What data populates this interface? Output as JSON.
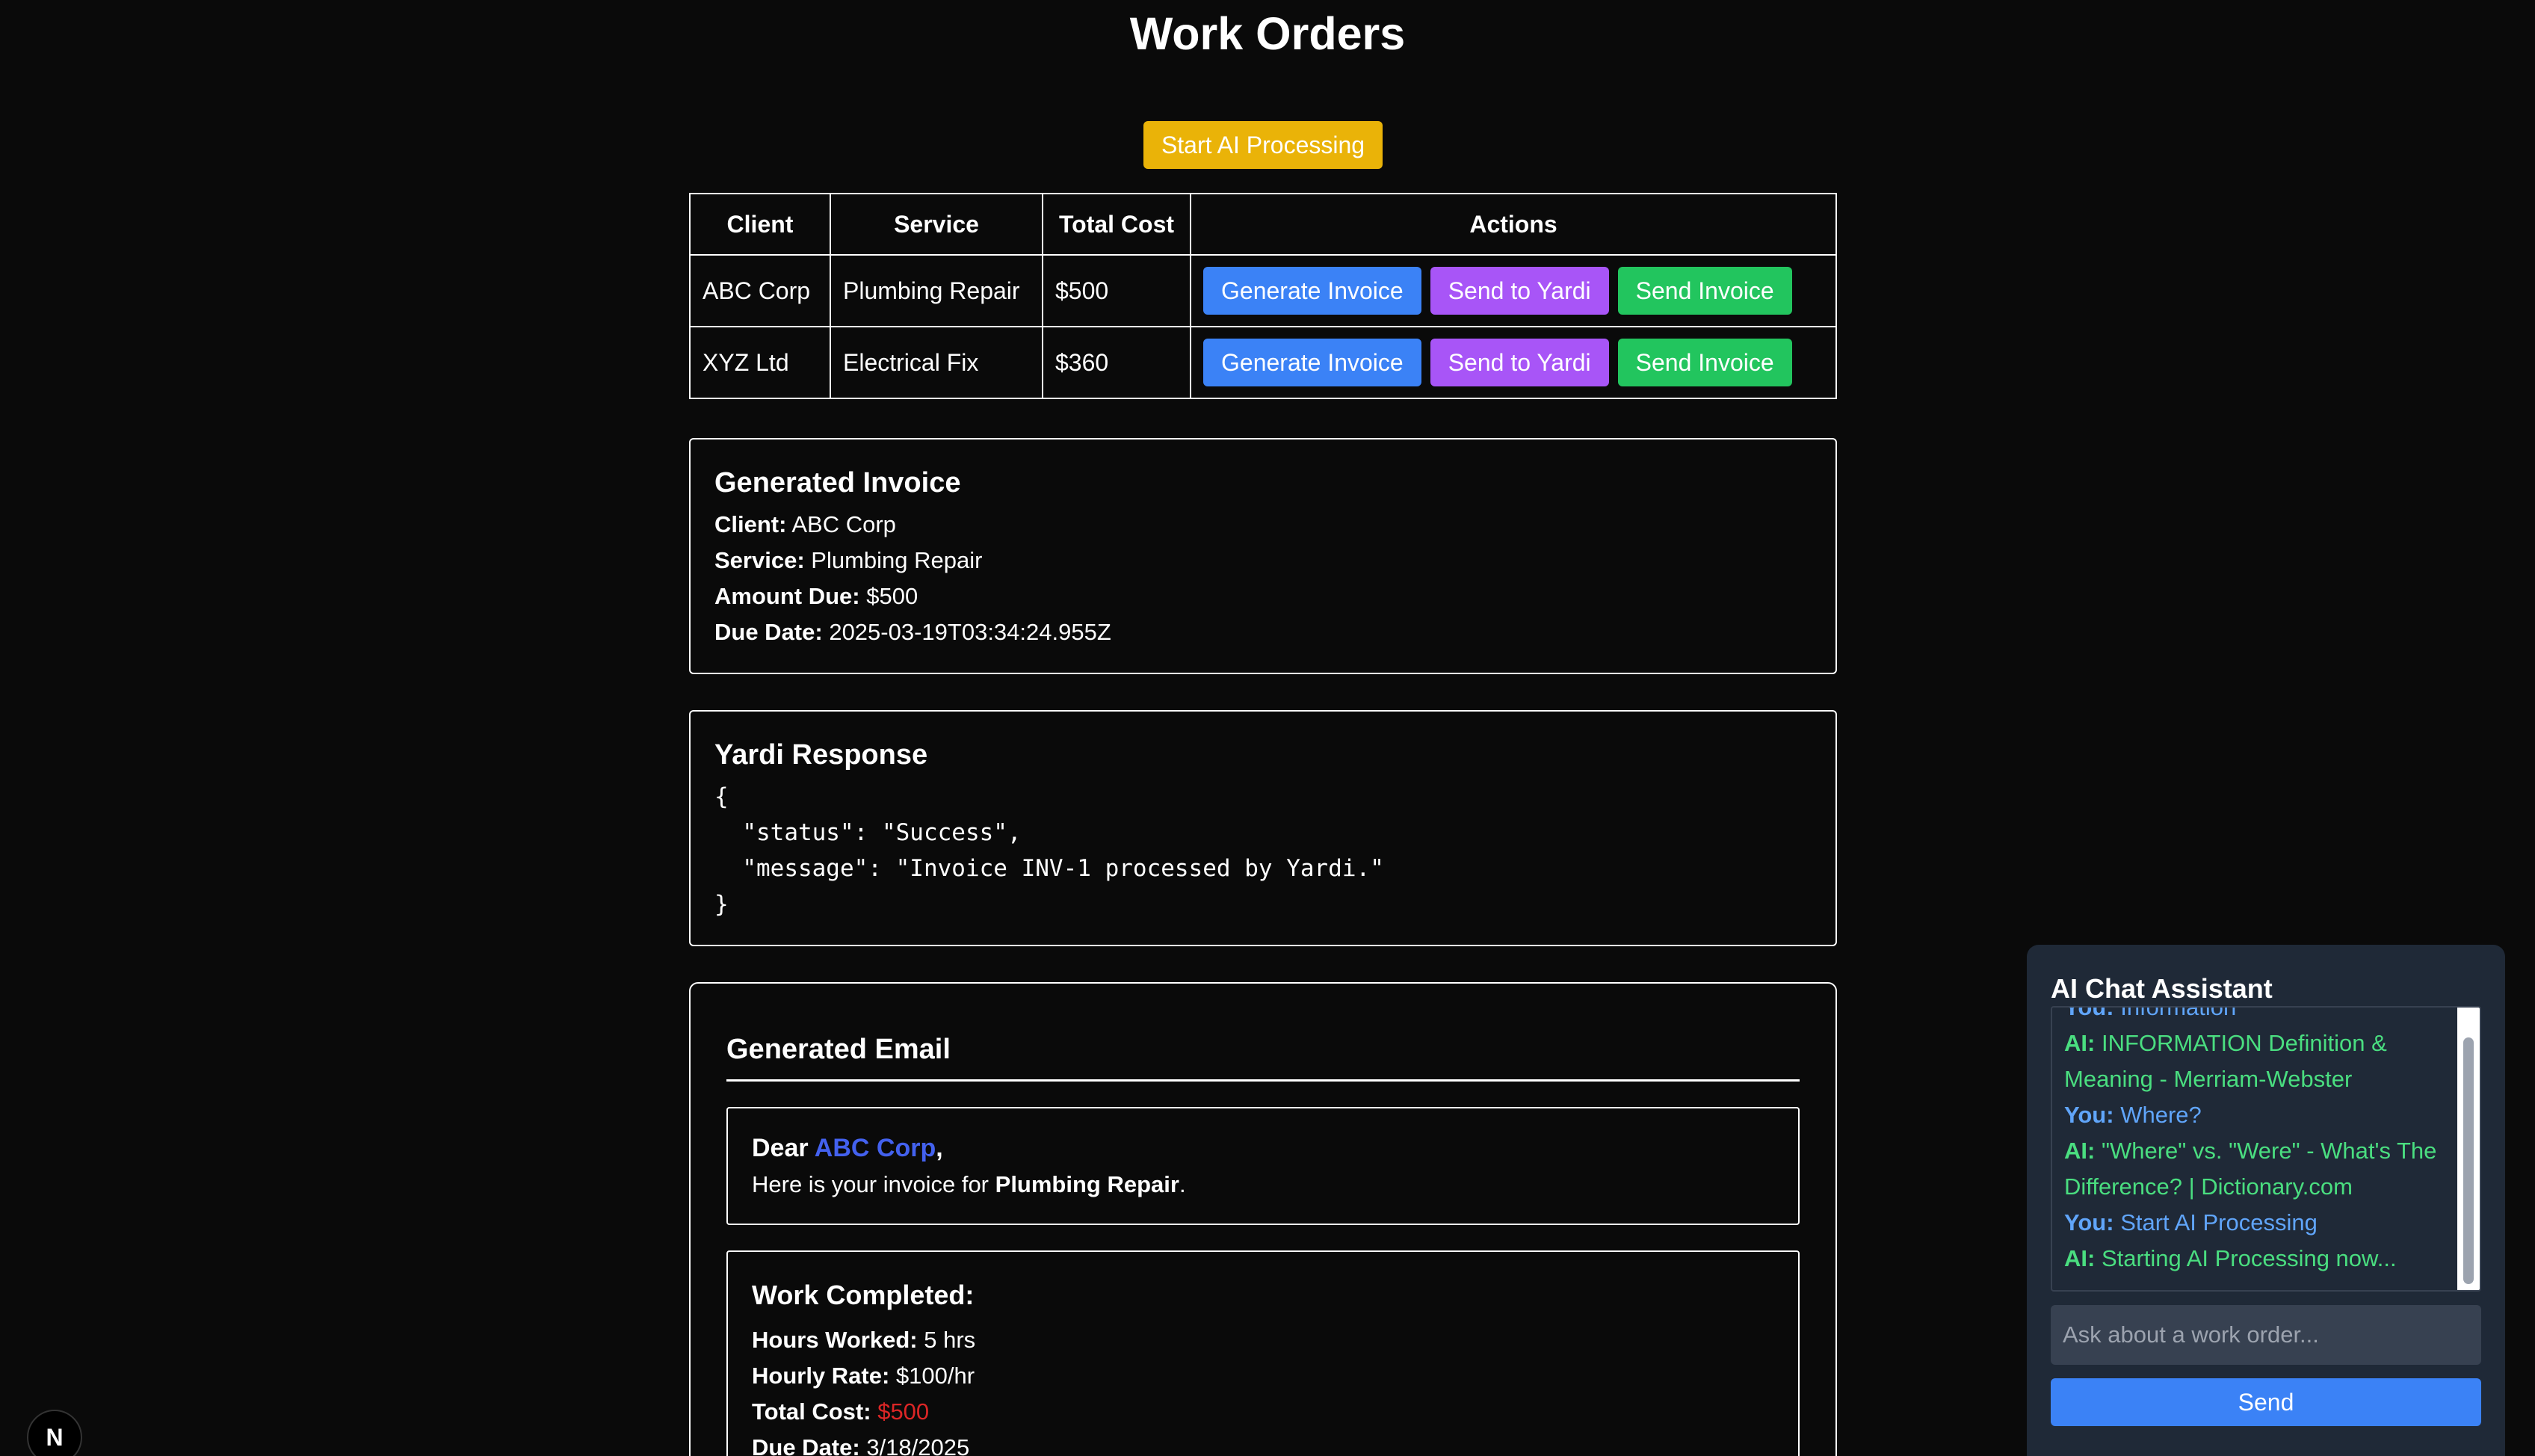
{
  "page": {
    "title": "Work Orders",
    "start_button": "Start AI Processing"
  },
  "table": {
    "headers": [
      "Client",
      "Service",
      "Total Cost",
      "Actions"
    ],
    "rows": [
      {
        "client": "ABC Corp",
        "service": "Plumbing Repair",
        "cost": "$500"
      },
      {
        "client": "XYZ Ltd",
        "service": "Electrical Fix",
        "cost": "$360"
      }
    ],
    "actions": {
      "generate": "Generate Invoice",
      "yardi": "Send to Yardi",
      "send": "Send Invoice"
    }
  },
  "invoice": {
    "title": "Generated Invoice",
    "client_label": "Client:",
    "client": "ABC Corp",
    "service_label": "Service:",
    "service": "Plumbing Repair",
    "amount_label": "Amount Due:",
    "amount": "$500",
    "due_label": "Due Date:",
    "due": "2025-03-19T03:34:24.955Z"
  },
  "yardi": {
    "title": "Yardi Response",
    "json": "{\n  \"status\": \"Success\",\n  \"message\": \"Invoice INV-1 processed by Yardi.\"\n}"
  },
  "email": {
    "title": "Generated Email",
    "dear": "Dear",
    "client": "ABC Corp",
    "comma": ",",
    "intro_prefix": "Here is your invoice for",
    "service": "Plumbing Repair",
    "period": ".",
    "work_title": "Work Completed:",
    "hours_label": "Hours Worked:",
    "hours": "5 hrs",
    "rate_label": "Hourly Rate:",
    "rate": "$100/hr",
    "total_label": "Total Cost:",
    "total": "$500",
    "due_label": "Due Date:",
    "due": "3/18/2025"
  },
  "badge": {
    "letter": "N"
  },
  "chat": {
    "title": "AI Chat Assistant",
    "messages": [
      {
        "who": "You:",
        "text": "Information"
      },
      {
        "who": "AI:",
        "text": "INFORMATION Definition & Meaning - Merriam-Webster"
      },
      {
        "who": "You:",
        "text": "Where?"
      },
      {
        "who": "AI:",
        "text": "\"Where\" vs. \"Were\" - What's The Difference? | Dictionary.com"
      },
      {
        "who": "You:",
        "text": "Start AI Processing"
      },
      {
        "who": "AI:",
        "text": "Starting AI Processing now..."
      }
    ],
    "input_placeholder": "Ask about a work order...",
    "send": "Send"
  },
  "colors": {
    "background": "#0a0a0a",
    "start_button": "#eab308",
    "generate": "#3b82f6",
    "yardi": "#a855f7",
    "send_invoice": "#22c55e",
    "chat_panel": "#1f2937",
    "chat_you": "#60a5fa",
    "chat_ai": "#4ade80",
    "total_cost": "#dc2626"
  }
}
